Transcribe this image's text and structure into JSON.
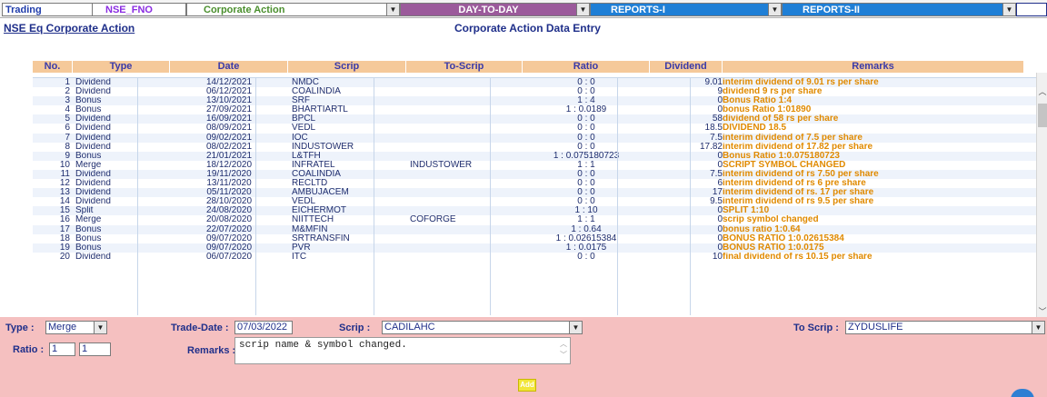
{
  "nav": {
    "trading": "Trading",
    "segment": "NSE_FNO",
    "module": "Corporate Action",
    "daytoday": "DAY-TO-DAY",
    "reports1": "REPORTS-I",
    "reports2": "REPORTS-II"
  },
  "breadcrumb": "NSE Eq Corporate Action",
  "heading": "Corporate Action Data Entry",
  "table": {
    "headers": [
      "No.",
      "Type",
      "Date",
      "Scrip",
      "To-Scrip",
      "Ratio",
      "Dividend",
      "Remarks"
    ],
    "rows": [
      [
        "1",
        "Dividend",
        "14/12/2021",
        "NMDC",
        "",
        "0 : 0",
        "9.01",
        "interim dividend of 9.01 rs per share"
      ],
      [
        "2",
        "Dividend",
        "06/12/2021",
        "COALINDIA",
        "",
        "0 : 0",
        "9",
        "dividend 9 rs per share"
      ],
      [
        "3",
        "Bonus",
        "13/10/2021",
        "SRF",
        "",
        "1 : 4",
        "0",
        "Bonus Ratio 1:4"
      ],
      [
        "4",
        "Bonus",
        "27/09/2021",
        "BHARTIARTL",
        "",
        "1 : 0.0189",
        "0",
        "bonus Ratio 1:01890"
      ],
      [
        "5",
        "Dividend",
        "16/09/2021",
        "BPCL",
        "",
        "0 : 0",
        "58",
        "dividend of 58 rs per share"
      ],
      [
        "6",
        "Dividend",
        "08/09/2021",
        "VEDL",
        "",
        "0 : 0",
        "18.5",
        "DIVIDEND 18.5"
      ],
      [
        "7",
        "Dividend",
        "09/02/2021",
        "IOC",
        "",
        "0 : 0",
        "7.5",
        "interim dividend of 7.5 per share"
      ],
      [
        "8",
        "Dividend",
        "08/02/2021",
        "INDUSTOWER",
        "",
        "0 : 0",
        "17.82",
        "interim dividend of 17.82 per share"
      ],
      [
        "9",
        "Bonus",
        "21/01/2021",
        "L&TFH",
        "",
        "1 : 0.075180723",
        "0",
        "Bonus Ratio 1:0.075180723"
      ],
      [
        "10",
        "Merge",
        "18/12/2020",
        "INFRATEL",
        "INDUSTOWER",
        "1 : 1",
        "0",
        "SCRIPT SYMBOL CHANGED"
      ],
      [
        "11",
        "Dividend",
        "19/11/2020",
        "COALINDIA",
        "",
        "0 : 0",
        "7.5",
        "interim dividend of rs 7.50 per share"
      ],
      [
        "12",
        "Dividend",
        "13/11/2020",
        "RECLTD",
        "",
        "0 : 0",
        "6",
        "interim dividend of rs 6 pre share"
      ],
      [
        "13",
        "Dividend",
        "05/11/2020",
        "AMBUJACEM",
        "",
        "0 : 0",
        "17",
        "interim dividend of rs. 17 per share"
      ],
      [
        "14",
        "Dividend",
        "28/10/2020",
        "VEDL",
        "",
        "0 : 0",
        "9.5",
        "interim dividend of rs 9.5 per share"
      ],
      [
        "15",
        "Split",
        "24/08/2020",
        "EICHERMOT",
        "",
        "1 : 10",
        "0",
        "SPLIT 1:10"
      ],
      [
        "16",
        "Merge",
        "20/08/2020",
        "NIITTECH",
        "COFORGE",
        "1 : 1",
        "0",
        "scrip symbol changed"
      ],
      [
        "17",
        "Bonus",
        "22/07/2020",
        "M&MFIN",
        "",
        "1 : 0.64",
        "0",
        "bonus ratio 1:0.64"
      ],
      [
        "18",
        "Bonus",
        "09/07/2020",
        "SRTRANSFIN",
        "",
        "1 : 0.02615384",
        "0",
        "BONUS RATIO 1:0.02615384"
      ],
      [
        "19",
        "Bonus",
        "09/07/2020",
        "PVR",
        "",
        "1 : 0.0175",
        "0",
        "BONUS RATIO 1:0.0175"
      ],
      [
        "20",
        "Dividend",
        "06/07/2020",
        "ITC",
        "",
        "0 : 0",
        "10",
        "final dividend of rs 10.15 per share"
      ]
    ]
  },
  "form": {
    "type_label": "Type :",
    "type_value": "Merge",
    "tradedate_label": "Trade-Date :",
    "tradedate_value": "07/03/2022",
    "scrip_label": "Scrip :",
    "scrip_value": "CADILAHC",
    "toscrip_label": "To Scrip :",
    "toscrip_value": "ZYDUSLIFE",
    "ratio_label": "Ratio :",
    "ratio_left": "1",
    "ratio_right": "1",
    "remarks_label": "Remarks :",
    "remarks_value": "scrip name & symbol changed.",
    "add_label": "Add"
  },
  "colors": {
    "header_bg": "#f5c99a",
    "form_bg": "#f5c0c0",
    "remark_text": "#e08a00",
    "label_text": "#1f2f8a"
  }
}
